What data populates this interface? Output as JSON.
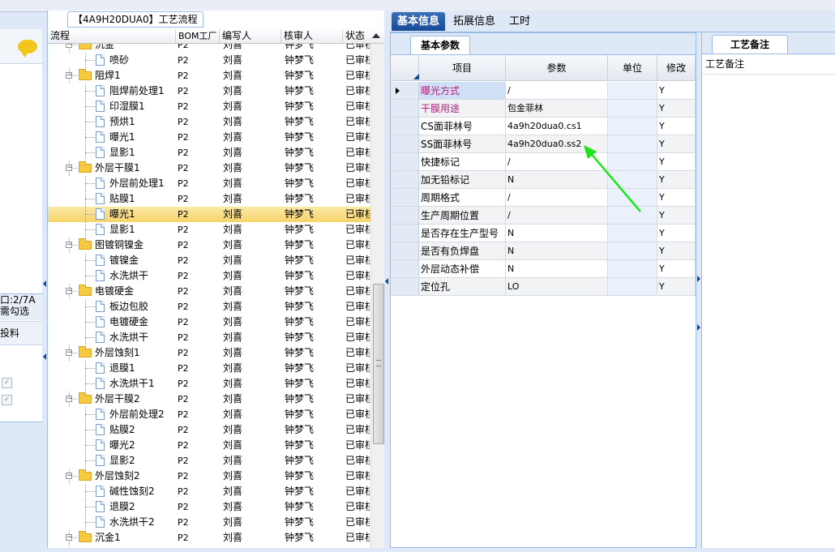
{
  "left_panel": {
    "info_line1": "口:2/7A",
    "info_line2": "需勾选",
    "col_header": "投料"
  },
  "tree_panel": {
    "title": "【4A9H20DUA0】工艺流程",
    "headers": {
      "flow": "流程",
      "bom": "BOM工厂",
      "author": "编写人",
      "reviewer": "核审人",
      "status": "状态"
    }
  },
  "tree_rows": [
    {
      "label": "沉金",
      "level": 0,
      "type": "folder",
      "bom": "P2",
      "author": "刘喜",
      "reviewer": "钟梦飞",
      "status": "已审核"
    },
    {
      "label": "喷砂",
      "level": 1,
      "type": "doc",
      "bom": "P2",
      "author": "刘喜",
      "reviewer": "钟梦飞",
      "status": "已审核"
    },
    {
      "label": "阻焊1",
      "level": 0,
      "type": "folder",
      "bom": "P2",
      "author": "刘喜",
      "reviewer": "钟梦飞",
      "status": "已审核"
    },
    {
      "label": "阻焊前处理1",
      "level": 1,
      "type": "doc",
      "bom": "P2",
      "author": "刘喜",
      "reviewer": "钟梦飞",
      "status": "已审核"
    },
    {
      "label": "印湿膜1",
      "level": 1,
      "type": "doc",
      "bom": "P2",
      "author": "刘喜",
      "reviewer": "钟梦飞",
      "status": "已审核"
    },
    {
      "label": "预烘1",
      "level": 1,
      "type": "doc",
      "bom": "P2",
      "author": "刘喜",
      "reviewer": "钟梦飞",
      "status": "已审核"
    },
    {
      "label": "曝光1",
      "level": 1,
      "type": "doc",
      "bom": "P2",
      "author": "刘喜",
      "reviewer": "钟梦飞",
      "status": "已审核"
    },
    {
      "label": "显影1",
      "level": 1,
      "type": "doc",
      "bom": "P2",
      "author": "刘喜",
      "reviewer": "钟梦飞",
      "status": "已审核"
    },
    {
      "label": "外层干膜1",
      "level": 0,
      "type": "folder",
      "bom": "P2",
      "author": "刘喜",
      "reviewer": "钟梦飞",
      "status": "已审核"
    },
    {
      "label": "外层前处理1",
      "level": 1,
      "type": "doc",
      "bom": "P2",
      "author": "刘喜",
      "reviewer": "钟梦飞",
      "status": "已审核"
    },
    {
      "label": "贴膜1",
      "level": 1,
      "type": "doc",
      "bom": "P2",
      "author": "刘喜",
      "reviewer": "钟梦飞",
      "status": "已审核"
    },
    {
      "label": "曝光1",
      "level": 1,
      "type": "doc",
      "bom": "P2",
      "author": "刘喜",
      "reviewer": "钟梦飞",
      "status": "已审核",
      "selected": true
    },
    {
      "label": "显影1",
      "level": 1,
      "type": "doc",
      "bom": "P2",
      "author": "刘喜",
      "reviewer": "钟梦飞",
      "status": "已审核"
    },
    {
      "label": "图镀铜镍金",
      "level": 0,
      "type": "folder",
      "bom": "P2",
      "author": "刘喜",
      "reviewer": "钟梦飞",
      "status": "已审核"
    },
    {
      "label": "镀镍金",
      "level": 1,
      "type": "doc",
      "bom": "P2",
      "author": "刘喜",
      "reviewer": "钟梦飞",
      "status": "已审核"
    },
    {
      "label": "水洗烘干",
      "level": 1,
      "type": "doc",
      "bom": "P2",
      "author": "刘喜",
      "reviewer": "钟梦飞",
      "status": "已审核"
    },
    {
      "label": "电镀硬金",
      "level": 0,
      "type": "folder",
      "bom": "P2",
      "author": "刘喜",
      "reviewer": "钟梦飞",
      "status": "已审核"
    },
    {
      "label": "板边包胶",
      "level": 1,
      "type": "doc",
      "bom": "P2",
      "author": "刘喜",
      "reviewer": "钟梦飞",
      "status": "已审核"
    },
    {
      "label": "电镀硬金",
      "level": 1,
      "type": "doc",
      "bom": "P2",
      "author": "刘喜",
      "reviewer": "钟梦飞",
      "status": "已审核"
    },
    {
      "label": "水洗烘干",
      "level": 1,
      "type": "doc",
      "bom": "P2",
      "author": "刘喜",
      "reviewer": "钟梦飞",
      "status": "已审核"
    },
    {
      "label": "外层蚀刻1",
      "level": 0,
      "type": "folder",
      "bom": "P2",
      "author": "刘喜",
      "reviewer": "钟梦飞",
      "status": "已审核"
    },
    {
      "label": "退膜1",
      "level": 1,
      "type": "doc",
      "bom": "P2",
      "author": "刘喜",
      "reviewer": "钟梦飞",
      "status": "已审核"
    },
    {
      "label": "水洗烘干1",
      "level": 1,
      "type": "doc",
      "bom": "P2",
      "author": "刘喜",
      "reviewer": "钟梦飞",
      "status": "已审核"
    },
    {
      "label": "外层干膜2",
      "level": 0,
      "type": "folder",
      "bom": "P2",
      "author": "刘喜",
      "reviewer": "钟梦飞",
      "status": "已审核"
    },
    {
      "label": "外层前处理2",
      "level": 1,
      "type": "doc",
      "bom": "P2",
      "author": "刘喜",
      "reviewer": "钟梦飞",
      "status": "已审核"
    },
    {
      "label": "贴膜2",
      "level": 1,
      "type": "doc",
      "bom": "P2",
      "author": "刘喜",
      "reviewer": "钟梦飞",
      "status": "已审核"
    },
    {
      "label": "曝光2",
      "level": 1,
      "type": "doc",
      "bom": "P2",
      "author": "刘喜",
      "reviewer": "钟梦飞",
      "status": "已审核"
    },
    {
      "label": "显影2",
      "level": 1,
      "type": "doc",
      "bom": "P2",
      "author": "刘喜",
      "reviewer": "钟梦飞",
      "status": "已审核"
    },
    {
      "label": "外层蚀刻2",
      "level": 0,
      "type": "folder",
      "bom": "P2",
      "author": "刘喜",
      "reviewer": "钟梦飞",
      "status": "已审核"
    },
    {
      "label": "碱性蚀刻2",
      "level": 1,
      "type": "doc",
      "bom": "P2",
      "author": "刘喜",
      "reviewer": "钟梦飞",
      "status": "已审核"
    },
    {
      "label": "退膜2",
      "level": 1,
      "type": "doc",
      "bom": "P2",
      "author": "刘喜",
      "reviewer": "钟梦飞",
      "status": "已审核"
    },
    {
      "label": "水洗烘干2",
      "level": 1,
      "type": "doc",
      "bom": "P2",
      "author": "刘喜",
      "reviewer": "钟梦飞",
      "status": "已审核"
    },
    {
      "label": "沉金1",
      "level": 0,
      "type": "folder",
      "bom": "P2",
      "author": "刘喜",
      "reviewer": "钟梦飞",
      "status": "已审核"
    }
  ],
  "tabs": [
    {
      "label": "基本信息",
      "active": true
    },
    {
      "label": "拓展信息",
      "active": false
    },
    {
      "label": "工时",
      "active": false
    }
  ],
  "basic_params": {
    "subtab": "基本参数",
    "headers": {
      "item": "项目",
      "param": "参数",
      "unit": "单位",
      "modify": "修改"
    },
    "rows": [
      {
        "item": "曝光方式",
        "param": "/",
        "unit": "",
        "modify": "Y",
        "highlight": true,
        "current": true
      },
      {
        "item": "干膜用途",
        "param": "包金菲林",
        "unit": "",
        "modify": "Y",
        "highlight": true
      },
      {
        "item": "CS面菲林号",
        "param": "4a9h20dua0.cs1",
        "unit": "",
        "modify": "Y"
      },
      {
        "item": "SS面菲林号",
        "param": "4a9h20dua0.ss2",
        "unit": "",
        "modify": "Y"
      },
      {
        "item": "快捷标记",
        "param": "/",
        "unit": "",
        "modify": "Y"
      },
      {
        "item": "加无铅标记",
        "param": "N",
        "unit": "",
        "modify": "Y"
      },
      {
        "item": "周期格式",
        "param": "/",
        "unit": "",
        "modify": "Y"
      },
      {
        "item": "生产周期位置",
        "param": "/",
        "unit": "",
        "modify": "Y"
      },
      {
        "item": "是否存在生产型号",
        "param": "N",
        "unit": "",
        "modify": "Y"
      },
      {
        "item": "是否有负焊盘",
        "param": "N",
        "unit": "",
        "modify": "Y"
      },
      {
        "item": "外层动态补偿",
        "param": "N",
        "unit": "",
        "modify": "Y"
      },
      {
        "item": "定位孔",
        "param": "LO",
        "unit": "",
        "modify": "Y"
      }
    ]
  },
  "craft_notes": {
    "tab": "工艺备注",
    "label": "工艺备注"
  },
  "colors": {
    "accent": "#17499a",
    "selection": "#f6d46a",
    "highlight_text": "#b0207a",
    "annotation_arrow": "#19e61a"
  }
}
